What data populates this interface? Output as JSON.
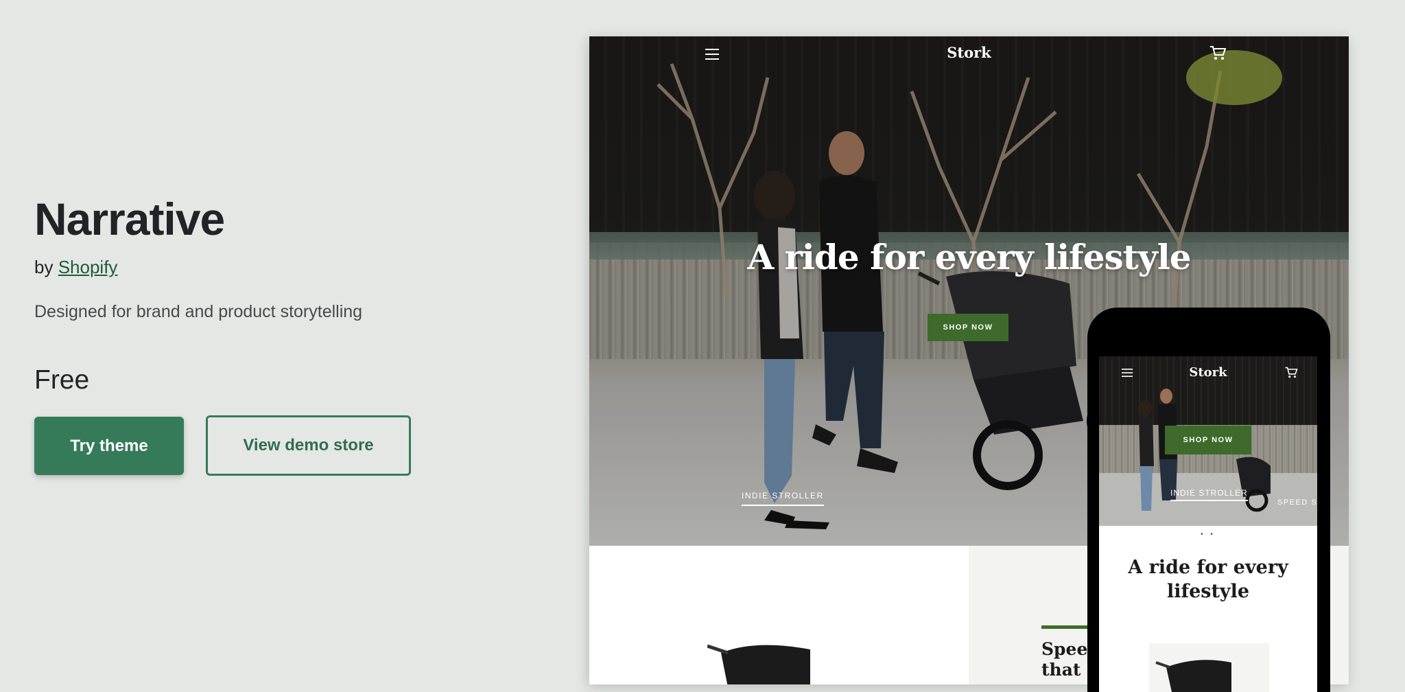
{
  "theme": {
    "name": "Narrative",
    "by_prefix": "by",
    "author": "Shopify",
    "tagline": "Designed for brand and product storytelling",
    "price": "Free"
  },
  "actions": {
    "try_theme": "Try theme",
    "view_demo": "View demo store"
  },
  "desktop_preview": {
    "brand": "Stork",
    "headline": "A ride for every lifestyle",
    "shop_now": "SHOP NOW",
    "caption": "INDIE STROLLER",
    "section_heading": "Speed\nthat k"
  },
  "mobile_preview": {
    "brand": "Stork",
    "shop_now": "SHOP NOW",
    "caption": "INDIE STROLLER",
    "caption_2": "SPEED ST",
    "dots": "• •",
    "heading": "A ride for every lifestyle"
  },
  "colors": {
    "background": "#e4e7e3",
    "primary_green": "#357b5a",
    "store_green": "#3e6b2b"
  },
  "icons": [
    "menu-icon",
    "cart-icon"
  ]
}
